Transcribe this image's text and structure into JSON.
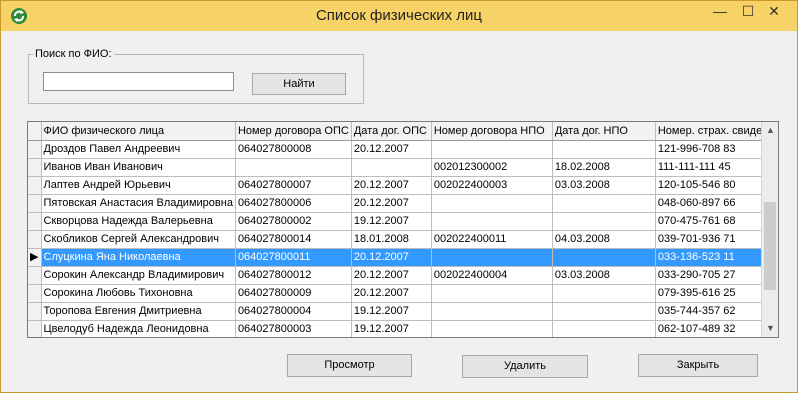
{
  "window": {
    "title": "Список физических лиц",
    "min_glyph": "—",
    "max_glyph": "☐",
    "close_glyph": "✕"
  },
  "search": {
    "group_label": "Поиск по ФИО:",
    "value": "",
    "find_label": "Найти"
  },
  "grid": {
    "columns": [
      "ФИО физического лица",
      "Номер договора ОПС",
      "Дата дог. ОПС",
      "Номер договора НПО",
      "Дата дог. НПО",
      "Номер. страх. свидет"
    ],
    "rows": [
      [
        "Дроздов Павел Андреевич",
        "064027800008",
        "20.12.2007",
        "",
        "",
        "121-996-708 83"
      ],
      [
        "Иванов Иван Иванович",
        "",
        "",
        "002012300002",
        "18.02.2008",
        "111-111-111 45"
      ],
      [
        "Лаптев Андрей Юрьевич",
        "064027800007",
        "20.12.2007",
        "002022400003",
        "03.03.2008",
        "120-105-546 80"
      ],
      [
        "Пятовская Анастасия Владимировна",
        "064027800006",
        "20.12.2007",
        "",
        "",
        "048-060-897 66"
      ],
      [
        "Скворцова  Надежда Валерьевна",
        "064027800002",
        "19.12.2007",
        "",
        "",
        "070-475-761 68"
      ],
      [
        "Скобликов  Сергей Александрович",
        "064027800014",
        "18.01.2008",
        "002022400011",
        "04.03.2008",
        "039-701-936 71"
      ],
      [
        "Слуцкина Яна Николаевна",
        "064027800011",
        "20.12.2007",
        "",
        "",
        "033-136-523 11"
      ],
      [
        "Сорокин Александр Владимирович",
        "064027800012",
        "20.12.2007",
        "002022400004",
        "03.03.2008",
        "033-290-705 27"
      ],
      [
        "Сорокина Любовь Тихоновна",
        "064027800009",
        "20.12.2007",
        "",
        "",
        "079-395-616 25"
      ],
      [
        "Торопова Евгения Дмитриевна",
        "064027800004",
        "19.12.2007",
        "",
        "",
        "035-744-357 62"
      ],
      [
        "Цвелодуб Надежда Леонидовна",
        "064027800003",
        "19.12.2007",
        "",
        "",
        "062-107-489 32"
      ]
    ],
    "selected_index": 6,
    "row_indicator": "▶"
  },
  "buttons": {
    "view_label": "Просмотр",
    "delete_label": "Удалить",
    "close_label": "Закрыть"
  },
  "colors": {
    "titlebar": "#f7d266",
    "selection": "#3399ff"
  },
  "icons": {
    "app": "app-refresh-icon",
    "scroll_up": "scroll-up-icon",
    "scroll_down": "scroll-down-icon"
  }
}
